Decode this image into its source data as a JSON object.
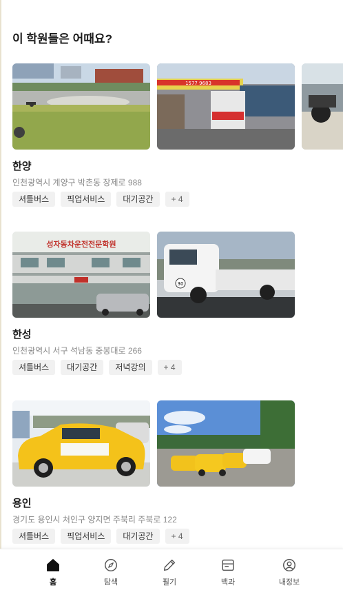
{
  "section": {
    "title": "이 학원들은 어때요?"
  },
  "academies": [
    {
      "name": "한양",
      "address": "인천광역시 계양구 박촌동 장제로 988",
      "tags": [
        "셔틀버스",
        "픽업서비스",
        "대기공간"
      ],
      "more_tags": "+ 4",
      "photos": [
        {
          "description": "driving-course-photo"
        },
        {
          "description": "academy-storefront-photo",
          "sign_text": "1577 9683"
        },
        {
          "description": "motorcycle-photo"
        }
      ]
    },
    {
      "name": "한성",
      "address": "인천광역시 서구 석남동 중봉대로 266",
      "tags": [
        "셔틀버스",
        "대기공간",
        "저녁강의"
      ],
      "more_tags": "+ 4",
      "photos": [
        {
          "description": "academy-building-photo",
          "sign_text": "성자동차운전전문학원"
        },
        {
          "description": "training-truck-photo",
          "badge_text": "30"
        }
      ]
    },
    {
      "name": "용인",
      "address": "경기도 용인시 처인구 양지면 주북리 주북로 122",
      "tags": [
        "셔틀버스",
        "픽업서비스",
        "대기공간"
      ],
      "more_tags": "+ 4",
      "photos": [
        {
          "description": "yellow-training-car-photo"
        },
        {
          "description": "training-course-cars-photo"
        }
      ]
    }
  ],
  "bottom_nav": [
    {
      "label": "홈",
      "icon": "home-icon",
      "active": true
    },
    {
      "label": "탐색",
      "icon": "compass-icon",
      "active": false
    },
    {
      "label": "필기",
      "icon": "pencil-icon",
      "active": false
    },
    {
      "label": "백과",
      "icon": "book-icon",
      "active": false
    },
    {
      "label": "내정보",
      "icon": "user-icon",
      "active": false
    }
  ],
  "colors": {
    "tag_background": "#f1f1f1",
    "address_text": "#8a8a8a",
    "active_nav": "#111111",
    "inactive_nav": "#555555"
  }
}
